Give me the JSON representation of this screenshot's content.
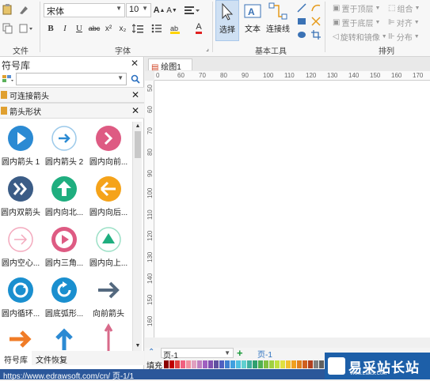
{
  "ribbon": {
    "font_name": "宋体",
    "font_size": "10",
    "labels": {
      "file": "文件",
      "font": "字体",
      "basic_tools": "基本工具",
      "arrange": "排列"
    },
    "tools": {
      "select": "选择",
      "text": "文本",
      "connector": "连接线"
    },
    "arrange_items": {
      "bring_front": "置于顶层",
      "send_back": "置于底层",
      "rotate_flip": "旋转和镜像",
      "group": "组合",
      "align": "对齐",
      "distribute": "分布"
    },
    "format_buttons": {
      "bold": "B",
      "italic": "I",
      "underline": "U",
      "strike": "abc",
      "superscript": "x²",
      "subscript": "x₂",
      "font_color": "A"
    }
  },
  "panel": {
    "title": "符号库",
    "categories": [
      {
        "label": "可连接箭头"
      },
      {
        "label": "箭头形状"
      }
    ],
    "shapes": [
      {
        "label": "圆内箭头 1",
        "icon": "circle-arrow-right-blue"
      },
      {
        "label": "圆内箭头 2",
        "icon": "circle-arrow-right-outline"
      },
      {
        "label": "圆内向前...",
        "icon": "circle-chevron-right-pink"
      },
      {
        "label": "圆内双箭头",
        "icon": "circle-double-chevron-navy"
      },
      {
        "label": "圆内向北...",
        "icon": "circle-arrow-up-green"
      },
      {
        "label": "圆内向后...",
        "icon": "circle-arrow-left-orange"
      },
      {
        "label": "圆内空心...",
        "icon": "circle-outline-arrow-pink"
      },
      {
        "label": "圆内三角...",
        "icon": "circle-play-pink"
      },
      {
        "label": "圆内向上...",
        "icon": "circle-triangle-up-teal"
      },
      {
        "label": "圆内循环...",
        "icon": "circle-cycle-blue"
      },
      {
        "label": "圆底弧形...",
        "icon": "circle-arc-blue"
      },
      {
        "label": "向前箭头",
        "icon": "arrow-right-slate"
      }
    ],
    "bottom_tabs": [
      "符号库",
      "文件恢复"
    ]
  },
  "canvas": {
    "doc_tab": "绘图1",
    "h_ticks": [
      "0",
      "60",
      "70",
      "80",
      "90",
      "100",
      "110",
      "120",
      "130",
      "140",
      "150",
      "160",
      "170"
    ],
    "v_ticks": [
      "50",
      "60",
      "70",
      "80",
      "90",
      "100",
      "110",
      "120",
      "130",
      "140",
      "150",
      "160"
    ]
  },
  "page_tabs": {
    "selector": "页-1",
    "tab": "页-1"
  },
  "fill_label": "填充",
  "swatch_colors": [
    "#8b0000",
    "#c00000",
    "#e04040",
    "#f06080",
    "#f090a0",
    "#e0a0c0",
    "#c080c0",
    "#a060c0",
    "#8050b0",
    "#6050a0",
    "#5060c0",
    "#4080d0",
    "#40a0e0",
    "#50c0e0",
    "#60d0d0",
    "#40b0a0",
    "#30a070",
    "#50b050",
    "#80c040",
    "#a0d040",
    "#c0e040",
    "#e0e040",
    "#f0c030",
    "#f0a020",
    "#e08020",
    "#d06020",
    "#b04020",
    "#808080",
    "#606060",
    "#404040"
  ],
  "status_text": "https://www.edrawsoft.com/cn/  页-1/1",
  "watermark": {
    "big": "易采站长站",
    "small": "Www.Easck.Com"
  }
}
